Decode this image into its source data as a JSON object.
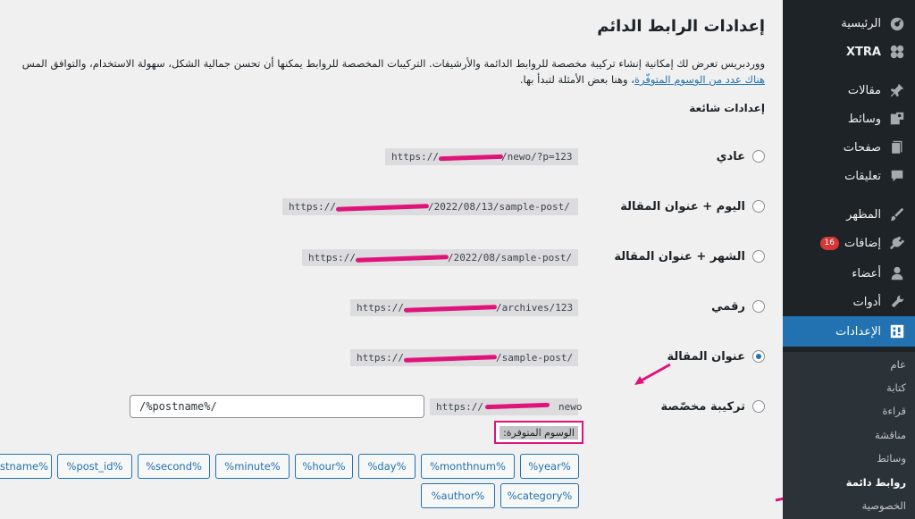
{
  "sidebar": {
    "items": [
      {
        "label": "الرئيسية",
        "icon": "dashboard-icon"
      },
      {
        "label": "XTRA",
        "icon": "xtra-logo-icon"
      },
      {
        "label": "مقالات",
        "icon": "pin-icon"
      },
      {
        "label": "وسائط",
        "icon": "media-icon"
      },
      {
        "label": "صفحات",
        "icon": "pages-icon"
      },
      {
        "label": "تعليقات",
        "icon": "comments-icon"
      },
      {
        "label": "المظهر",
        "icon": "brush-icon"
      },
      {
        "label": "إضافات",
        "icon": "plugins-icon",
        "badge": "16"
      },
      {
        "label": "أعضاء",
        "icon": "users-icon"
      },
      {
        "label": "أدوات",
        "icon": "tools-icon"
      },
      {
        "label": "الإعدادات",
        "icon": "settings-icon"
      }
    ],
    "submenu": [
      "عام",
      "كتابة",
      "قراءة",
      "مناقشة",
      "وسائط",
      "روابط دائمة",
      "الخصوصية"
    ]
  },
  "page": {
    "title": "إعدادات الرابط الدائم",
    "intro_line1": "ووردبريس تعرض لك إمكانية إنشاء تركيبة مخصصة للروابط الدائمة والأرشيفات. التركيبات المخصصة للروابط يمكنها أن تحسن جمالية الشكل، سهولة الاستخدام، والتوافق المس",
    "intro_link": "هناك عدد من الوسوم المتوفّرة",
    "intro_line2_rest": "، وهنا بعض الأمثلة لتبدأ بها.",
    "common_heading": "إعدادات شائعة"
  },
  "options": [
    {
      "label": "عادي",
      "sample_prefix": "https://",
      "sample_suffix": "/newo/?p=123",
      "checked": false
    },
    {
      "label": "اليوم + عنوان المقالة",
      "sample_prefix": "https://",
      "sample_suffix": "/2022/08/13/sample-post/",
      "checked": false
    },
    {
      "label": "الشهر + عنوان المقالة",
      "sample_prefix": "https://",
      "sample_suffix": "/2022/08/sample-post/",
      "checked": false
    },
    {
      "label": "رقمي",
      "sample_prefix": "https://",
      "sample_suffix": "/archives/123",
      "checked": false
    },
    {
      "label": "عنوان المقالة",
      "sample_prefix": "https://",
      "sample_suffix": "/sample-post/",
      "checked": true
    },
    {
      "label": "تركيبة مخصّصة",
      "sample_prefix": "https://",
      "sample_suffix": "newo",
      "checked": false
    }
  ],
  "custom": {
    "input_value": "/%postname%/",
    "tags_label": "الوسوم المتوفرة:",
    "tags_row1": [
      "%year%",
      "%monthnum%",
      "%day%",
      "%hour%",
      "%minute%",
      "%second%",
      "%post_id%",
      "stname%"
    ],
    "tags_row2": [
      "%category%",
      "%author%"
    ]
  },
  "colors": {
    "sidebar_bg": "#1d2327",
    "accent": "#2271b1",
    "highlight": "#e0137a",
    "badge": "#d63638"
  }
}
